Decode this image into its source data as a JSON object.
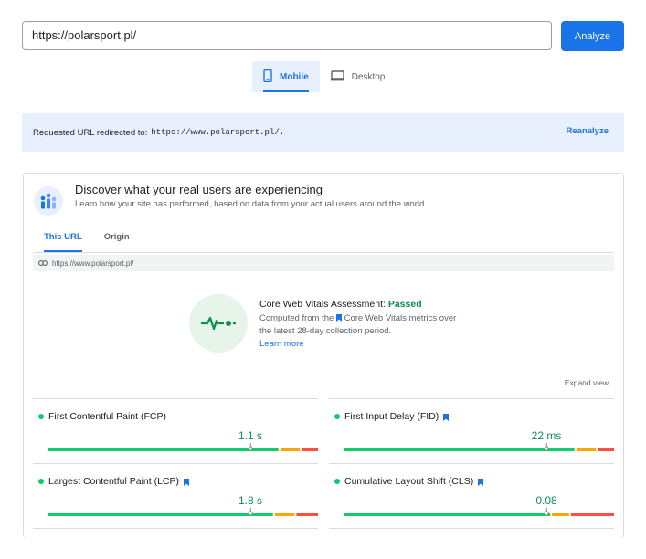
{
  "search": {
    "url_value": "https://polarsport.pl/"
  },
  "toolbar": {
    "analyze_label": "Analyze"
  },
  "device_tabs": [
    {
      "label": "Mobile",
      "icon": "phone-icon",
      "active": true
    },
    {
      "label": "Desktop",
      "icon": "monitor-icon",
      "active": false
    }
  ],
  "redirect": {
    "prefix": "Requested URL redirected to:",
    "url": "https://www.polarsport.pl/.",
    "action_label": "Reanalyze"
  },
  "crux": {
    "title": "Discover what your real users are experiencing",
    "subtitle": "Learn how your site has performed, based on data from your actual users around the world.",
    "tabs": [
      {
        "label": "This URL",
        "active": true
      },
      {
        "label": "Origin",
        "active": false
      }
    ],
    "page_url": "https://www.polarsport.pl/"
  },
  "assessment": {
    "label": "Core Web Vitals Assessment:",
    "status": "Passed",
    "desc_prefix": "Computed from the",
    "desc_suffix": "Core Web Vitals metrics over the latest 28-day collection period.",
    "learn_more": "Learn more",
    "status_color": "#0d904f"
  },
  "expand_label": "Expand view",
  "metrics": [
    {
      "label": "First Contentful Paint (FCP)",
      "value": "1.1 s",
      "core": false,
      "marker": 0.75,
      "split": [
        0.86,
        0.94
      ]
    },
    {
      "label": "First Input Delay (FID)",
      "value": "22 ms",
      "core": true,
      "marker": 0.75,
      "split": [
        0.86,
        0.94
      ]
    },
    {
      "label": "Largest Contentful Paint (LCP)",
      "value": "1.8 s",
      "core": true,
      "marker": 0.75,
      "split": [
        0.84,
        0.92
      ]
    },
    {
      "label": "Cumulative Layout Shift (CLS)",
      "value": "0.08",
      "core": true,
      "marker": 0.75,
      "split": [
        0.77,
        0.84
      ]
    }
  ],
  "colors": {
    "good": "#0cce6b",
    "average": "#ffa400",
    "poor": "#ff4e42",
    "accent": "#1a73e8"
  }
}
